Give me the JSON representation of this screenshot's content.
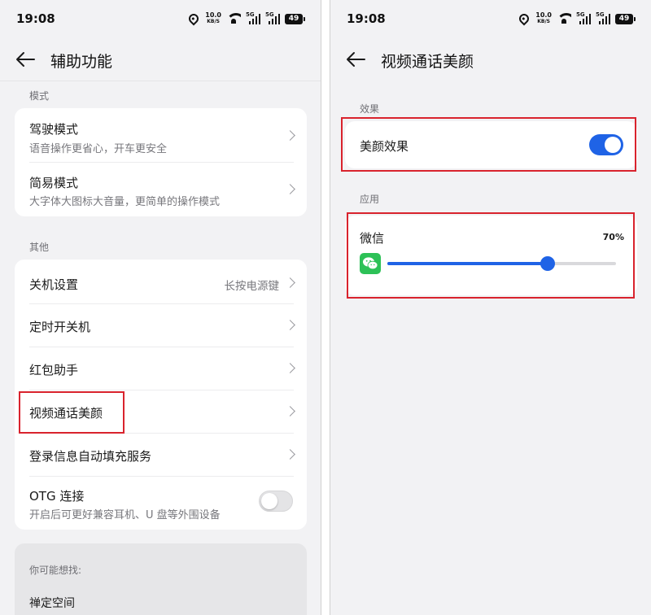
{
  "status_bar": {
    "time": "19:08",
    "speed_value": "10.0",
    "speed_unit": "KB/S",
    "sim1_tag": "5G",
    "sim2_tag": "5G",
    "battery": "49"
  },
  "left": {
    "header": {
      "title": "辅助功能"
    },
    "sections": {
      "mode_label": "模式",
      "other_label": "其他"
    },
    "mode_items": [
      {
        "title": "驾驶模式",
        "subtitle": "语音操作更省心，开车更安全"
      },
      {
        "title": "简易模式",
        "subtitle": "大字体大图标大音量，更简单的操作模式"
      }
    ],
    "other_items": [
      {
        "title": "关机设置",
        "value": "长按电源键"
      },
      {
        "title": "定时开关机"
      },
      {
        "title": "红包助手"
      },
      {
        "title": "视频通话美颜"
      },
      {
        "title": "登录信息自动填充服务"
      },
      {
        "title": "OTG 连接",
        "subtitle": "开启后可更好兼容耳机、U 盘等外围设备",
        "toggle": "off"
      }
    ],
    "suggest": {
      "label": "你可能想找:",
      "items": [
        "禅定空间"
      ]
    }
  },
  "right": {
    "header": {
      "title": "视频通话美颜"
    },
    "effect_label": "效果",
    "effect_item": {
      "title": "美颜效果",
      "toggle": "on"
    },
    "apps_label": "应用",
    "app_item": {
      "name": "微信",
      "percent_text": "70%",
      "value": 0.7
    }
  },
  "colors": {
    "accent": "#1f63e6",
    "highlight": "#d9232d",
    "background": "#f2f2f4",
    "wechat": "#2dc157"
  },
  "icons": [
    "back-arrow-icon",
    "chevron-right-icon",
    "location-icon",
    "wifi-icon",
    "signal-icon",
    "battery-icon",
    "wechat-icon"
  ]
}
